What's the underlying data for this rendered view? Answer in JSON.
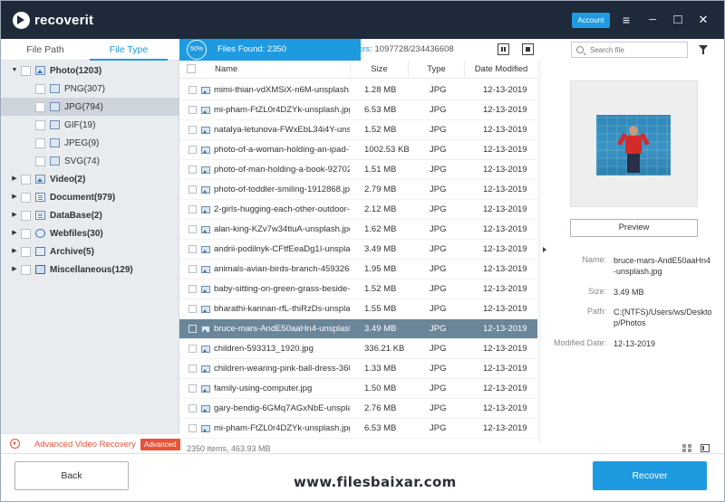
{
  "app": {
    "brand": "recoverit",
    "account_label": "Account"
  },
  "window_controls": {
    "menu": "≡",
    "minimize": "─",
    "maximize": "□",
    "close": "✕"
  },
  "left_tabs": [
    {
      "label": "File Path"
    },
    {
      "label": "File Type"
    }
  ],
  "tree": [
    {
      "label": "Photo(1203)",
      "expanded": true,
      "icon": "image-folder-icon"
    },
    {
      "label": "PNG(307)",
      "icon": "folder-icon"
    },
    {
      "label": "JPG(794)",
      "icon": "folder-icon",
      "selected": true
    },
    {
      "label": "GIF(19)",
      "icon": "folder-icon"
    },
    {
      "label": "JPEG(9)",
      "icon": "folder-icon"
    },
    {
      "label": "SVG(74)",
      "icon": "folder-icon"
    },
    {
      "label": "Video(2)",
      "icon": "video-icon"
    },
    {
      "label": "Document(979)",
      "icon": "document-icon"
    },
    {
      "label": "DataBase(2)",
      "icon": "database-icon"
    },
    {
      "label": "Webfiles(30)",
      "icon": "web-icon"
    },
    {
      "label": "Archive(5)",
      "icon": "archive-icon"
    },
    {
      "label": "Miscellaneous(129)",
      "icon": "misc-icon"
    }
  ],
  "advanced": {
    "label": "Advanced Video Recovery",
    "badge": "Advanced"
  },
  "scan": {
    "percent": "50%",
    "files_found_label": "Files Found:",
    "files_found": "2350",
    "sectors_label": "Reading Sectors:",
    "sectors": "1097728/234436608"
  },
  "search": {
    "placeholder": "Search file"
  },
  "table": {
    "headers": {
      "name": "Name",
      "size": "Size",
      "type": "Type",
      "date": "Date Modified"
    },
    "rows": [
      {
        "name": "mimi-thian-vdXMSiX-n6M-unsplash.jpg",
        "size": "1.28  MB",
        "type": "JPG",
        "date": "12-13-2019"
      },
      {
        "name": "mi-pham-FtZL0r4DZYk-unsplash.jpg",
        "size": "6.53  MB",
        "type": "JPG",
        "date": "12-13-2019"
      },
      {
        "name": "natalya-letunova-FWxEbL34i4Y-unspl...",
        "size": "1.52  MB",
        "type": "JPG",
        "date": "12-13-2019"
      },
      {
        "name": "photo-of-a-woman-holding-an-ipad-7...",
        "size": "1002.53  KB",
        "type": "JPG",
        "date": "12-13-2019"
      },
      {
        "name": "photo-of-man-holding-a-book-92702...",
        "size": "1.51  MB",
        "type": "JPG",
        "date": "12-13-2019"
      },
      {
        "name": "photo-of-toddler-smiling-1912868.jpg",
        "size": "2.79  MB",
        "type": "JPG",
        "date": "12-13-2019"
      },
      {
        "name": "2-girls-hugging-each-other-outdoor-...",
        "size": "2.12  MB",
        "type": "JPG",
        "date": "12-13-2019"
      },
      {
        "name": "alan-king-KZv7w34tluA-unsplash.jpg",
        "size": "1.62  MB",
        "type": "JPG",
        "date": "12-13-2019"
      },
      {
        "name": "andrii-podilnyk-CFtfEeaDg1I-unsplas...",
        "size": "3.49  MB",
        "type": "JPG",
        "date": "12-13-2019"
      },
      {
        "name": "animals-avian-birds-branch-459326.j...",
        "size": "1.95  MB",
        "type": "JPG",
        "date": "12-13-2019"
      },
      {
        "name": "baby-sitting-on-green-grass-beside-...",
        "size": "1.52  MB",
        "type": "JPG",
        "date": "12-13-2019"
      },
      {
        "name": "bharathi-kannan-rfL-thiRzDs-unsplas...",
        "size": "1.55  MB",
        "type": "JPG",
        "date": "12-13-2019"
      },
      {
        "name": "bruce-mars-AndE50aaHn4-unsplash....",
        "size": "3.49  MB",
        "type": "JPG",
        "date": "12-13-2019",
        "selected": true
      },
      {
        "name": "children-593313_1920.jpg",
        "size": "336.21  KB",
        "type": "JPG",
        "date": "12-13-2019"
      },
      {
        "name": "children-wearing-pink-ball-dress-360...",
        "size": "1.33  MB",
        "type": "JPG",
        "date": "12-13-2019"
      },
      {
        "name": "family-using-computer.jpg",
        "size": "1.50  MB",
        "type": "JPG",
        "date": "12-13-2019"
      },
      {
        "name": "gary-bendig-6GMq7AGxNbE-unsplas...",
        "size": "2.76  MB",
        "type": "JPG",
        "date": "12-13-2019"
      },
      {
        "name": "mi-pham-FtZL0r4DZYk-unsplash.jpg",
        "size": "6.53  MB",
        "type": "JPG",
        "date": "12-13-2019"
      }
    ]
  },
  "status": {
    "count": "2350 items, 463.93  MB"
  },
  "preview": {
    "button": "Preview",
    "name_label": "Name:",
    "name": "bruce-mars-AndE50aaHn4-unsplash.jpg",
    "size_label": "Size:",
    "size": "3.49  MB",
    "path_label": "Path:",
    "path": "C:(NTFS)/Users/ws/Desktop/Photos",
    "date_label": "Modified Date:",
    "date": "12-13-2019"
  },
  "footer": {
    "back": "Back",
    "recover": "Recover",
    "watermark": "www.filesbaixar.com"
  }
}
